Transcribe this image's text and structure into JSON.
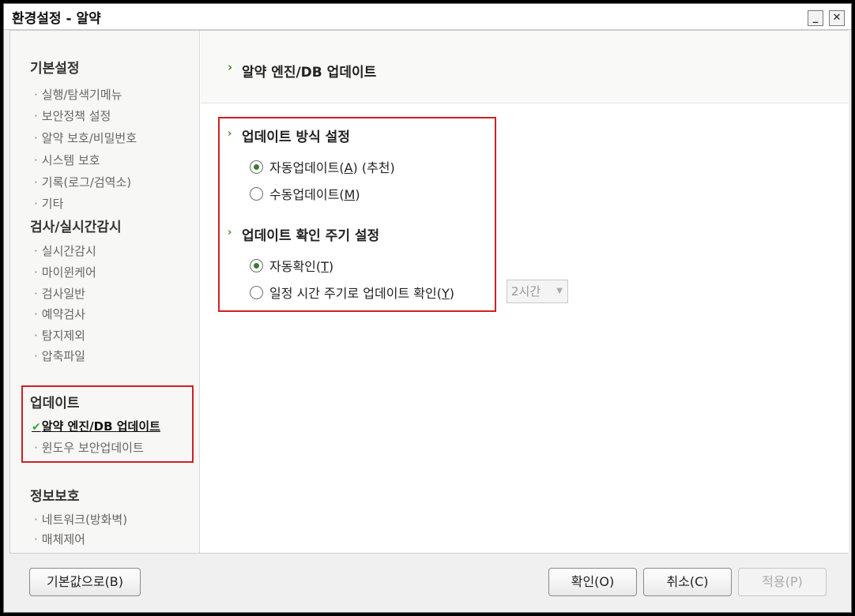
{
  "window": {
    "title": "환경설정 - 알약",
    "minimize_label": "_",
    "close_label": "✕"
  },
  "sidebar": {
    "sections": [
      {
        "title": "기본설정",
        "items": [
          "실행/탐색기메뉴",
          "보안정책 설정",
          "알약 보호/비밀번호",
          "시스템 보호",
          "기록(로그/검역소)",
          "기타"
        ]
      },
      {
        "title": "검사/실시간감시",
        "items": [
          "실시간감시",
          "마이윈케어",
          "검사일반",
          "예약검사",
          "탐지제외",
          "압축파일"
        ]
      },
      {
        "title": "업데이트",
        "items": [
          "알약 엔진/DB 업데이트",
          "윈도우 보안업데이트"
        ]
      },
      {
        "title": "정보보호",
        "items": [
          "네트워크(방화벽)",
          "매체제어"
        ]
      }
    ],
    "active_item": "알약 엔진/DB 업데이트"
  },
  "content": {
    "page_title": "알약 엔진/DB 업데이트",
    "group1": {
      "title": "업데이트 방식 설정",
      "options": [
        {
          "label_pre": "자동업데이트(",
          "key": "A",
          "label_post": ") (추천)",
          "checked": true
        },
        {
          "label_pre": "수동업데이트(",
          "key": "M",
          "label_post": ")",
          "checked": false
        }
      ]
    },
    "group2": {
      "title": "업데이트 확인 주기 설정",
      "options": [
        {
          "label_pre": "자동확인(",
          "key": "T",
          "label_post": ")",
          "checked": true
        },
        {
          "label_pre": "일정 시간 주기로 업데이트 확인(",
          "key": "Y",
          "label_post": ")",
          "checked": false
        }
      ],
      "interval_select": {
        "value": "2시간",
        "enabled": false
      }
    }
  },
  "buttons": {
    "defaults": "기본값으로(B)",
    "ok": "확인(O)",
    "cancel": "취소(C)",
    "apply": "적용(P)"
  },
  "colors": {
    "accent_green": "#3b8b2c",
    "highlight_red": "#cc2222"
  }
}
